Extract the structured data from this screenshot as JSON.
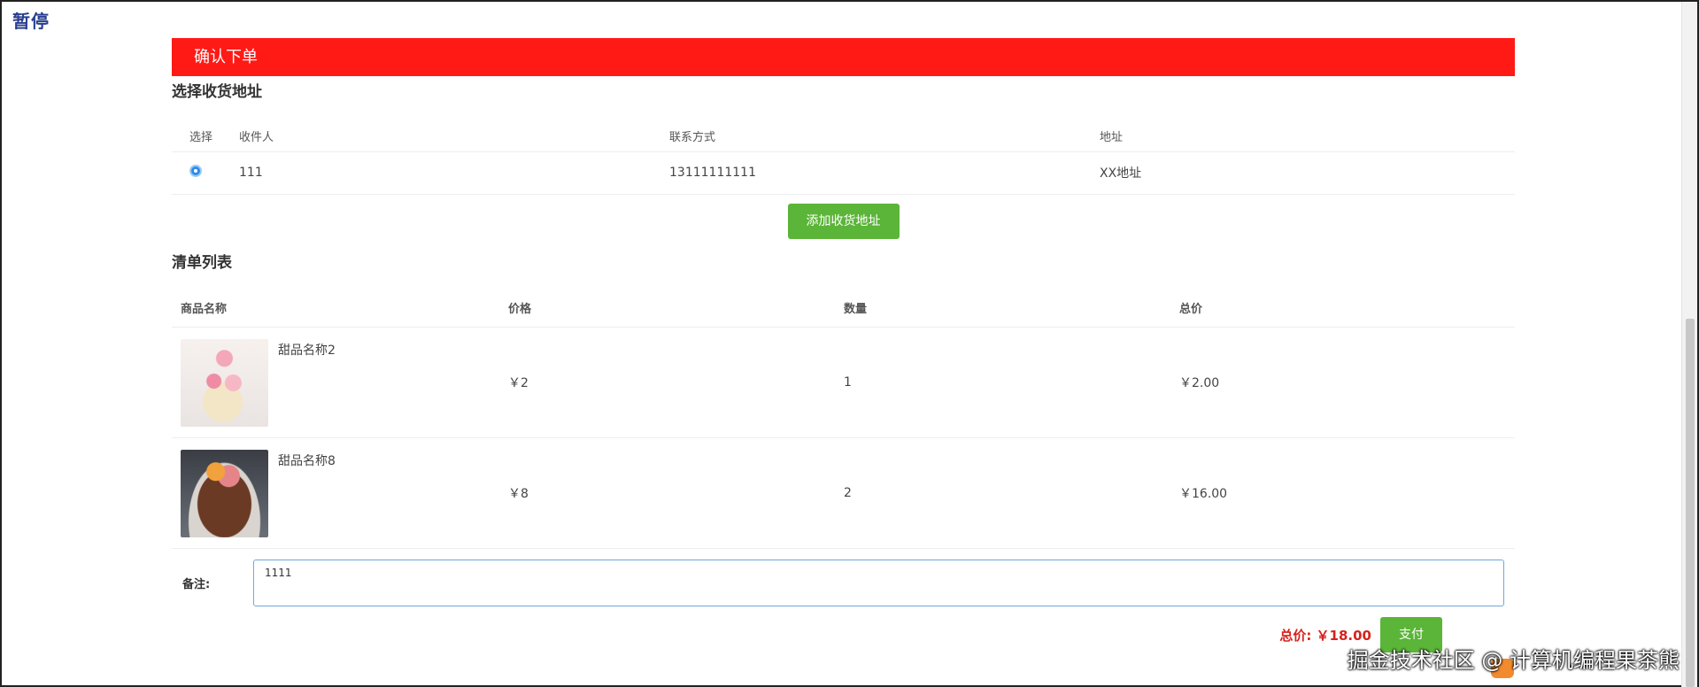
{
  "overlay": {
    "pause_text": "暂停"
  },
  "header": {
    "title": "确认下单"
  },
  "address": {
    "section_title": "选择收货地址",
    "columns": [
      "选择",
      "收件人",
      "联系方式",
      "地址"
    ],
    "rows": [
      {
        "recipient": "111",
        "phone": "13111111111",
        "address": "XX地址",
        "selected": true
      }
    ],
    "add_button_label": "添加收货地址"
  },
  "goods": {
    "section_title": "清单列表",
    "columns": [
      "商品名称",
      "价格",
      "数量",
      "总价"
    ],
    "rows": [
      {
        "name": "甜品名称2",
        "price": "￥2",
        "quantity": "1",
        "total": "￥2.00"
      },
      {
        "name": "甜品名称8",
        "price": "￥8",
        "quantity": "2",
        "total": "￥16.00"
      }
    ]
  },
  "remark": {
    "label": "备注:",
    "value": "1111"
  },
  "summary": {
    "total_label": "总价: ￥18.00",
    "pay_label": "支付"
  },
  "watermark": {
    "text": "掘金技术社区 @ 计算机编程果茶熊"
  },
  "colors": {
    "header_bg": "#ff1a16",
    "button_green": "#5bb538",
    "total_red": "#d8221b",
    "radio_blue": "#2d8ce8"
  }
}
